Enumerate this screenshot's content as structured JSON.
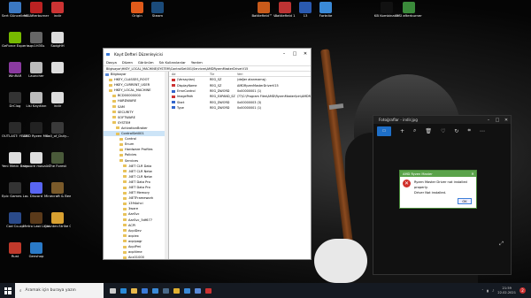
{
  "desktop_icons": [
    {
      "name": "sert-guncelleme-icon",
      "label": "Sert Güncelleme",
      "color": "#3b78c2"
    },
    {
      "name": "msiafterburner-icon",
      "label": "MSIAfterburner",
      "color": "#b22"
    },
    {
      "name": "indir-icon",
      "label": "indir",
      "color": "#c33"
    },
    {
      "name": "geforce-experience-icon",
      "label": "GeForce Experience",
      "color": "#76b900"
    },
    {
      "name": "sqlv1-icon",
      "label": "sqv1H3Ss",
      "color": "#666"
    },
    {
      "name": "sadgdh-icon",
      "label": "SadgHH",
      "color": "#ddd"
    },
    {
      "name": "winrar-icon",
      "label": "WinRAR",
      "color": "#8a3aa0"
    },
    {
      "name": "launcher-icon",
      "label": "Launcher",
      "color": "#bbb"
    },
    {
      "name": "file-icon",
      "label": "",
      "color": "#ddd"
    },
    {
      "name": "drclog-icon",
      "label": "DrClog",
      "color": "#333"
    },
    {
      "name": "lisi-kayitlari-icon",
      "label": "Lisi Kayıtları",
      "color": "#bbb"
    },
    {
      "name": "indir2-icon",
      "label": "indir",
      "color": "#ddd"
    },
    {
      "name": "outlast-icon",
      "label": "OUTLAST: YEDEK",
      "color": "#2a2a2a"
    },
    {
      "name": "amd-ryzen-master-icon",
      "label": "AMD Ryzen Master",
      "color": "#222"
    },
    {
      "name": "call-of-duty-icon",
      "label": "Call_of_Duty...",
      "color": "#3a3a3a"
    },
    {
      "name": "yeni-metin-belgesi-icon",
      "label": "Yeni Metin Belgesi",
      "color": "#ddd"
    },
    {
      "name": "smoore-masaustu-icon",
      "label": "smoore masaüstü",
      "color": "#ddd"
    },
    {
      "name": "the-forest-icon",
      "label": "The Forest",
      "color": "#4a5a3a"
    },
    {
      "name": "epic-games-launcher-icon",
      "label": "Epic Games Launcher",
      "color": "#333"
    },
    {
      "name": "discord-icon",
      "label": "Discord",
      "color": "#5865f2"
    },
    {
      "name": "minecraft-icon",
      "label": "Minecraft & Bee",
      "color": "#7a5a2a"
    },
    {
      "name": "cod-co-op-icon",
      "label": "Cod Co-op",
      "color": "#2a4a8a"
    },
    {
      "name": "metro-last-light-icon",
      "label": "Metro Last Light Redux",
      "color": "#5a3a1a"
    },
    {
      "name": "counter-strike-icon",
      "label": "Counter-Strike Global Offe...",
      "color": "#d8a030"
    },
    {
      "name": "rust-icon",
      "label": "Rust",
      "color": "#c0392b"
    },
    {
      "name": "genshin-icon",
      "label": "Genshop",
      "color": "#2a7ac8"
    }
  ],
  "top_icons": [
    {
      "name": "origin-icon",
      "label": "Origin",
      "color": "#e05a1a"
    },
    {
      "name": "steam-icon",
      "label": "Steam",
      "color": "#1b4b7a"
    },
    {
      "name": "battlefield-v-icon",
      "label": "Battlefield™ V",
      "color": "#c85a1a"
    },
    {
      "name": "battlefield-1-icon",
      "label": "Battlefield 1",
      "color": "#b33"
    },
    {
      "name": "game-icon",
      "label": "13",
      "color": "#2a5ab0"
    },
    {
      "name": "fortnite-icon",
      "label": "Fortnite",
      "color": "#3a8ad8"
    },
    {
      "name": "kb-kombinator-icon",
      "label": "KB Kombinatör",
      "color": "#111"
    },
    {
      "name": "msi-afterburner-top-icon",
      "label": "MSI afterburner",
      "color": "#3a8a3a"
    }
  ],
  "regedit": {
    "title": "Kayıt Defteri Düzenleyicisi",
    "menu": [
      "Dosya",
      "Düzen",
      "Görünüm",
      "Sık Kullanılanlar",
      "Yardım"
    ],
    "address": "Bilgisayar\\HKEY_LOCAL_MACHINE\\SYSTEM\\ControlSet001\\Services\\AMDRyzenMasterDriverV15",
    "tree": [
      "Bilgisayar",
      "HKEY_CLASSES_ROOT",
      "HKEY_CURRENT_USER",
      "HKEY_LOCAL_MACHINE",
      "BCD00000000",
      "HARDWARE",
      "SAM",
      "SECURITY",
      "SOFTWARE",
      "SYSTEM",
      "ActivationBroker",
      "ControlSet001",
      "Control",
      "Enum",
      "Hardware Profiles",
      "Policies",
      "Services",
      ".NET CLR Data",
      ".NET CLR Netw",
      ".NET CLR Netw",
      ".NET Data Pro",
      ".NET Data Pro",
      ".NET Memory",
      ".NETFramework",
      "1394ohci",
      "3ware",
      "AarSvc",
      "AarSvc_5df677",
      "ACPI",
      "AcpiDev",
      "acpiex",
      "acpipagr",
      "AcpiPmi",
      "acpitime",
      "Acx01000",
      "ADOVMPPack"
    ],
    "columns": [
      "Ad",
      "Tür",
      "Veri"
    ],
    "values": [
      {
        "name": "(Varsayılan)",
        "type": "REG_SZ",
        "data": "(değer atanmamış)",
        "icon": "#c33"
      },
      {
        "name": "DisplayName",
        "type": "REG_SZ",
        "data": "AMDRyzenMasterDriverV15",
        "icon": "#c33"
      },
      {
        "name": "ErrorControl",
        "type": "REG_DWORD",
        "data": "0x00000001 (1)",
        "icon": "#36c"
      },
      {
        "name": "ImagePath",
        "type": "REG_EXPAND_SZ",
        "data": "\\??\\C:\\Program Files\\AMD\\RyzenMaster\\bin\\AMDRyzenMasterDriver.sys",
        "icon": "#c33"
      },
      {
        "name": "Start",
        "type": "REG_DWORD",
        "data": "0x00000003 (3)",
        "icon": "#36c"
      },
      {
        "name": "Type",
        "type": "REG_DWORD",
        "data": "0x00000001 (1)",
        "icon": "#36c"
      }
    ]
  },
  "photos": {
    "title": "Fotoğraflar - indir.jpg"
  },
  "dialog": {
    "title": "AMD Ryzen Master",
    "line1": "Ryzen Master Driver not installed properly.",
    "line2": "Driver Not installed.",
    "ok": "OK"
  },
  "taskbar": {
    "search_placeholder": "Aramak için buraya yazın",
    "apps": [
      {
        "name": "task-view-icon",
        "color": "#ccc"
      },
      {
        "name": "edge-icon",
        "color": "#2a8ad8"
      },
      {
        "name": "explorer-icon",
        "color": "#e8b84a"
      },
      {
        "name": "store-icon",
        "color": "#3a7ad8"
      },
      {
        "name": "mail-icon",
        "color": "#3a8ad8"
      },
      {
        "name": "steam-taskbar-icon",
        "color": "#4a6a8a"
      },
      {
        "name": "chrome-icon",
        "color": "#e0b030"
      },
      {
        "name": "photos-taskbar-icon",
        "color": "#3a8ad8"
      },
      {
        "name": "regedit-taskbar-icon",
        "color": "#5a8ad8"
      },
      {
        "name": "amd-taskbar-icon",
        "color": "#c33"
      }
    ],
    "time": "21:59",
    "date": "22.02.2021",
    "notifications": "2"
  }
}
